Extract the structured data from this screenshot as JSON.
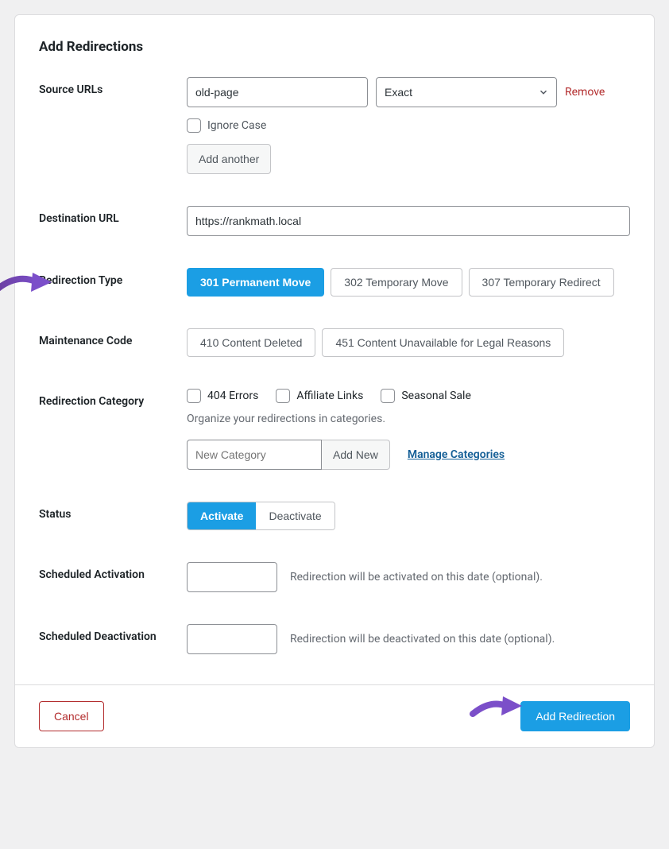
{
  "title": "Add Redirections",
  "sourceUrls": {
    "label": "Source URLs",
    "value": "old-page",
    "matchType": "Exact",
    "removeLabel": "Remove",
    "ignoreCaseLabel": "Ignore Case",
    "addAnotherLabel": "Add another"
  },
  "destination": {
    "label": "Destination URL",
    "value": "https://rankmath.local"
  },
  "redirectionType": {
    "label": "Redirection Type",
    "options": {
      "opt301": "301 Permanent Move",
      "opt302": "302 Temporary Move",
      "opt307": "307 Temporary Redirect"
    }
  },
  "maintenance": {
    "label": "Maintenance Code",
    "options": {
      "opt410": "410 Content Deleted",
      "opt451": "451 Content Unavailable for Legal Reasons"
    }
  },
  "category": {
    "label": "Redirection Category",
    "options": {
      "cat404": "404 Errors",
      "catAffiliate": "Affiliate Links",
      "catSeasonal": "Seasonal Sale"
    },
    "helpText": "Organize your redirections in categories.",
    "newCategoryPlaceholder": "New Category",
    "addNewLabel": "Add New",
    "manageLink": "Manage Categories"
  },
  "status": {
    "label": "Status",
    "activate": "Activate",
    "deactivate": "Deactivate"
  },
  "scheduledActivation": {
    "label": "Scheduled Activation",
    "hint": "Redirection will be activated on this date (optional)."
  },
  "scheduledDeactivation": {
    "label": "Scheduled Deactivation",
    "hint": "Redirection will be deactivated on this date (optional)."
  },
  "footer": {
    "cancel": "Cancel",
    "submit": "Add Redirection"
  }
}
